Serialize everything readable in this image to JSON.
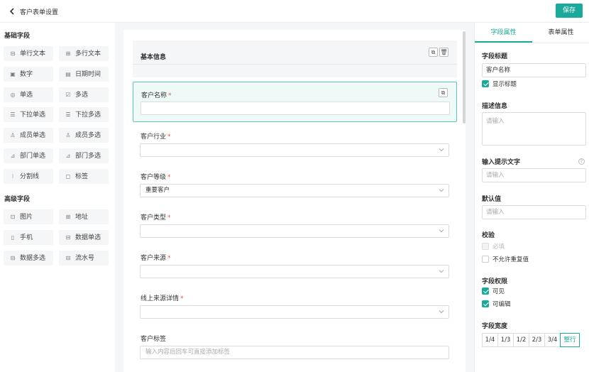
{
  "header": {
    "back_icon": "chevron-left-icon",
    "title": "客户表单设置",
    "save_label": "保存"
  },
  "left": {
    "basic_title": "基础字段",
    "basic_items": [
      {
        "label": "单行文本",
        "icon": "single-line-text-icon",
        "glyph": "⊟"
      },
      {
        "label": "多行文本",
        "icon": "multi-line-text-icon",
        "glyph": "⊞"
      },
      {
        "label": "数字",
        "icon": "number-icon",
        "glyph": "▣"
      },
      {
        "label": "日期时间",
        "icon": "calendar-icon",
        "glyph": "▤"
      },
      {
        "label": "单选",
        "icon": "radio-icon",
        "glyph": "◎"
      },
      {
        "label": "多选",
        "icon": "checkbox-icon",
        "glyph": "☑"
      },
      {
        "label": "下拉单选",
        "icon": "dropdown-single-icon",
        "glyph": "☰"
      },
      {
        "label": "下拉多选",
        "icon": "dropdown-multi-icon",
        "glyph": "☰"
      },
      {
        "label": "成员单选",
        "icon": "member-single-icon",
        "glyph": "♙"
      },
      {
        "label": "成员多选",
        "icon": "member-multi-icon",
        "glyph": "♙"
      },
      {
        "label": "部门单选",
        "icon": "department-single-icon",
        "glyph": "⊿"
      },
      {
        "label": "部门多选",
        "icon": "department-multi-icon",
        "glyph": "⊿"
      },
      {
        "label": "分割线",
        "icon": "divider-icon",
        "glyph": "⁝"
      },
      {
        "label": "标签",
        "icon": "tag-icon",
        "glyph": "◻"
      }
    ],
    "advanced_title": "高级字段",
    "advanced_items": [
      {
        "label": "图片",
        "icon": "image-icon",
        "glyph": "⊡"
      },
      {
        "label": "地址",
        "icon": "map-icon",
        "glyph": "⊞"
      },
      {
        "label": "手机",
        "icon": "phone-icon",
        "glyph": "▯"
      },
      {
        "label": "数据单选",
        "icon": "data-single-icon",
        "glyph": "⊟"
      },
      {
        "label": "数据多选",
        "icon": "data-multi-icon",
        "glyph": "⊟"
      },
      {
        "label": "流水号",
        "icon": "serial-number-icon",
        "glyph": "⊟"
      }
    ]
  },
  "canvas": {
    "group_title": "基本信息",
    "required_mark": "*",
    "fields": [
      {
        "label": "客户名称",
        "required": true,
        "value": "",
        "placeholder": "",
        "dropdown": false
      },
      {
        "label": "客户行业",
        "required": true,
        "value": "",
        "placeholder": "",
        "dropdown": true
      },
      {
        "label": "客户等级",
        "required": true,
        "value": "重要客户",
        "placeholder": "",
        "dropdown": true
      },
      {
        "label": "客户类型",
        "required": true,
        "value": "",
        "placeholder": "",
        "dropdown": true
      },
      {
        "label": "客户来源",
        "required": true,
        "value": "",
        "placeholder": "",
        "dropdown": true
      },
      {
        "label": "线上来源详情",
        "required": true,
        "value": "",
        "placeholder": "",
        "dropdown": true
      },
      {
        "label": "客户标签",
        "required": false,
        "value": "",
        "placeholder": "输入内容后回车可直接添加标签",
        "dropdown": false
      }
    ]
  },
  "props": {
    "tabs": [
      "字段属性",
      "表单属性"
    ],
    "active_tab": 0,
    "field_title_label": "字段标题",
    "field_title_value": "客户名称",
    "show_title_label": "显示标题",
    "show_title_checked": true,
    "desc_label": "描述信息",
    "desc_placeholder": "请输入",
    "hint_label": "输入提示文字",
    "hint_placeholder": "请输入",
    "default_label": "默认值",
    "default_placeholder": "请输入",
    "validation_label": "校验",
    "required_label": "必填",
    "no_dup_label": "不允许重复值",
    "perm_label": "字段权限",
    "visible_label": "可见",
    "editable_label": "可编辑",
    "width_label": "字段宽度",
    "widths": [
      "1/4",
      "1/3",
      "1/2",
      "2/3",
      "3/4",
      "整行"
    ],
    "active_width": "整行"
  }
}
